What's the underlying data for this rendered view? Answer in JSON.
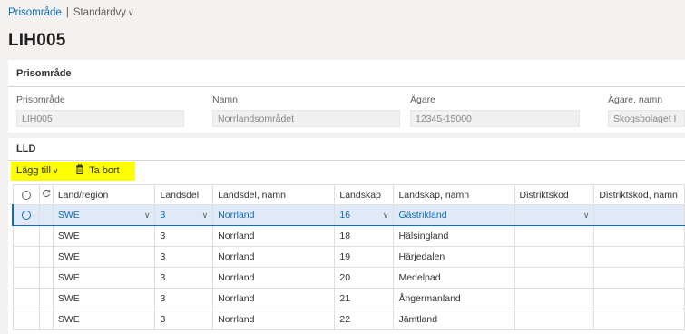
{
  "breadcrumb": {
    "link": "Prisområde",
    "separator": "|",
    "view": "Standardvy"
  },
  "page_title": "LIH005",
  "header_card": {
    "title": "Prisområde",
    "fields": [
      {
        "label": "Prisområde",
        "value": "LIH005"
      },
      {
        "label": "Namn",
        "value": "Norrlandsområdet"
      },
      {
        "label": "Ägare",
        "value": "12345-15000"
      },
      {
        "label": "Ägare, namn",
        "value": "Skogsbolaget I"
      }
    ]
  },
  "lld": {
    "title": "LLD",
    "toolbar": {
      "add_label": "Lägg till",
      "delete_label": "Ta bort"
    },
    "columns": [
      "Land/region",
      "Landsdel",
      "Landsdel, namn",
      "Landskap",
      "Landskap, namn",
      "Distriktskod",
      "Distriktskod, namn"
    ],
    "rows": [
      [
        "SWE",
        "3",
        "Norrland",
        "16",
        "Gästrikland",
        "",
        ""
      ],
      [
        "SWE",
        "3",
        "Norrland",
        "18",
        "Hälsingland",
        "",
        ""
      ],
      [
        "SWE",
        "3",
        "Norrland",
        "19",
        "Härjedalen",
        "",
        ""
      ],
      [
        "SWE",
        "3",
        "Norrland",
        "20",
        "Medelpad",
        "",
        ""
      ],
      [
        "SWE",
        "3",
        "Norrland",
        "21",
        "Ångermanland",
        "",
        ""
      ],
      [
        "SWE",
        "3",
        "Norrland",
        "22",
        "Jämtland",
        "",
        ""
      ]
    ]
  },
  "colors": {
    "accent": "#0f6cbd",
    "highlight": "#ffff00",
    "selected_row": "#dfe9f7"
  }
}
